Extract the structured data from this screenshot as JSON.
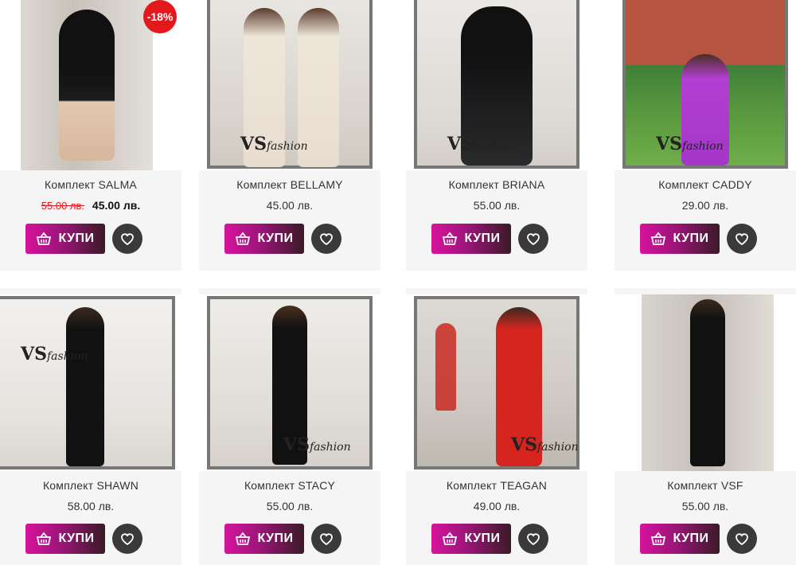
{
  "products": [
    {
      "name": "Комплект SALMA",
      "old_price": "55.00 лв.",
      "price": "45.00 лв.",
      "badge": "-18%"
    },
    {
      "name": "Комплект BELLAMY",
      "price": "45.00 лв."
    },
    {
      "name": "Комплект BRIANA",
      "price": "55.00 лв."
    },
    {
      "name": "Комплект CADDY",
      "price": "29.00 лв."
    },
    {
      "name": "Комплект SHAWN",
      "price": "58.00 лв."
    },
    {
      "name": "Комплект STACY",
      "price": "55.00 лв."
    },
    {
      "name": "Комплект TEAGAN",
      "price": "49.00 лв."
    },
    {
      "name": "Комплект VSF",
      "price": "55.00 лв."
    }
  ],
  "buttons": {
    "buy_label": "КУПИ"
  },
  "watermark": {
    "logo": "VS",
    "text": "fashion"
  },
  "colors": {
    "sale_red": "#e3181c",
    "buy_gradient_start": "#d6139d",
    "buy_gradient_end": "#3a1a26",
    "wishlist_bg": "#3a3a3a"
  },
  "icons": {
    "buy": "basket-icon",
    "wishlist": "heart-icon"
  }
}
